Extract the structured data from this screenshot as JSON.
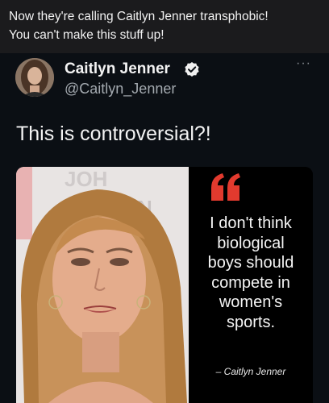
{
  "caption": {
    "line1": "Now they're calling Caitlyn Jenner transphobic!",
    "line2": "You can't make this stuff up!"
  },
  "tweet": {
    "author_name": "Caitlyn Jenner",
    "handle": "@Caitlyn_Jenner",
    "more_label": "···",
    "text": "This is controversial?!"
  },
  "media": {
    "quote_lines": [
      "I don't think",
      "biological",
      "boys should",
      "compete in",
      "women's",
      "sports."
    ],
    "attribution": "– Caitlyn Jenner"
  },
  "colors": {
    "caption_bg": "#1b1b1d",
    "tweet_bg": "#0b0f14",
    "verified_badge": "#f0f0f0",
    "quote_mark": "#e23a2e"
  },
  "icons": {
    "verified": "verified-badge-icon",
    "more": "more-options-icon",
    "quote": "quote-mark-icon"
  }
}
